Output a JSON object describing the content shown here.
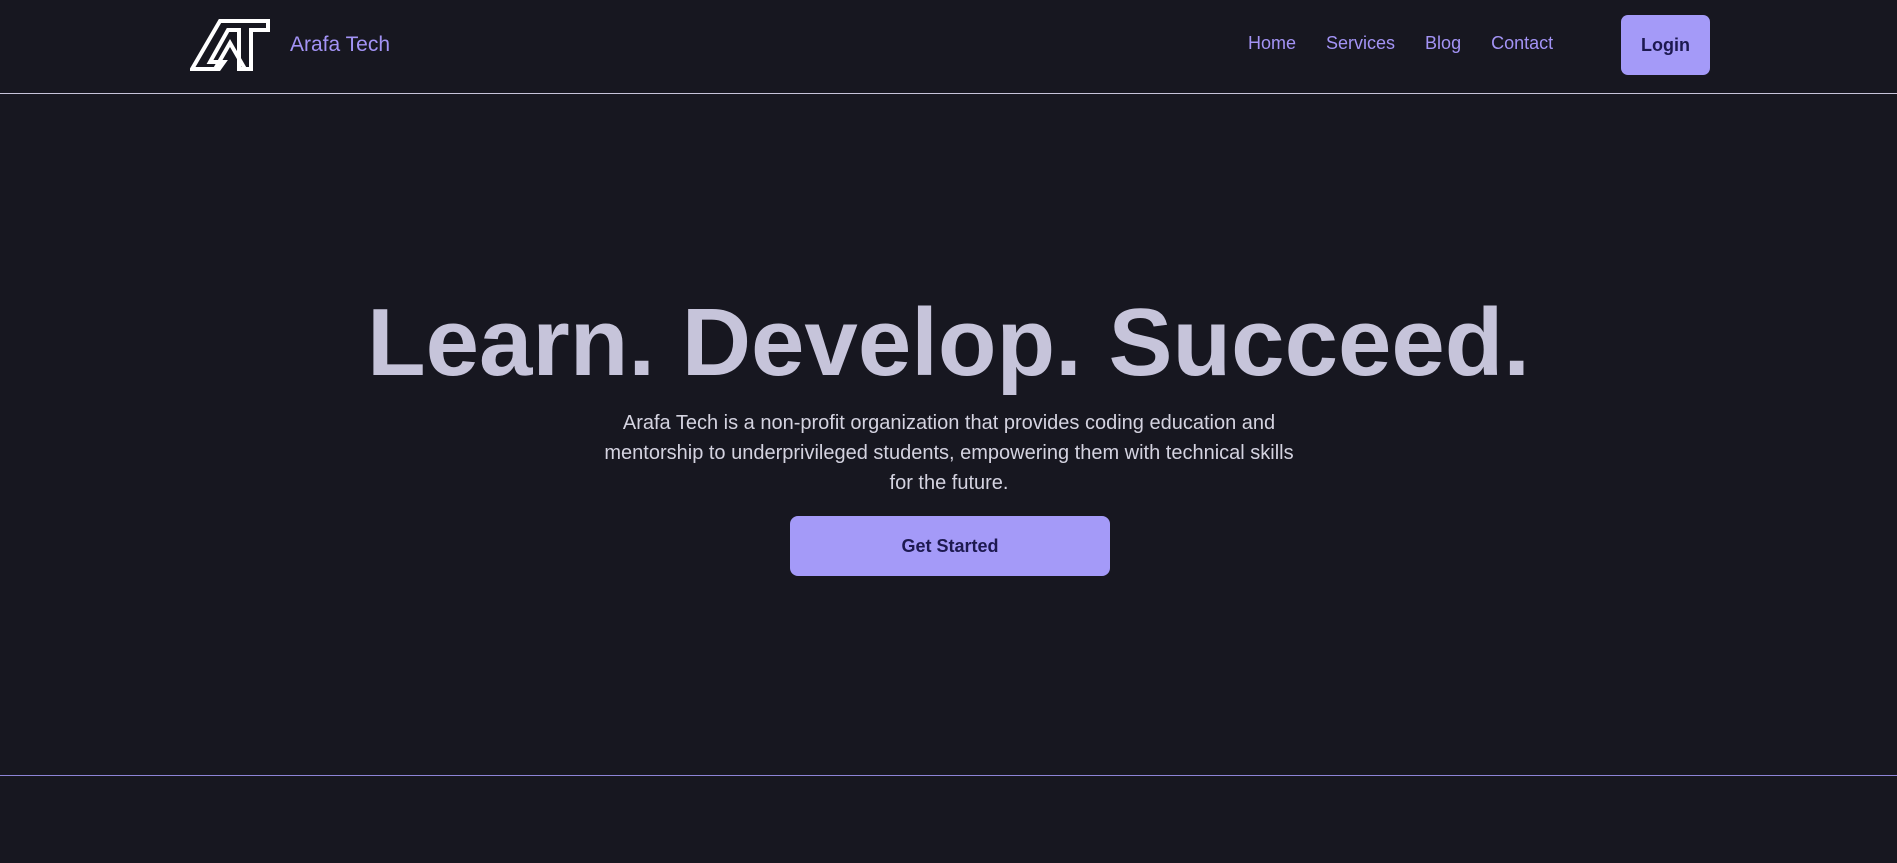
{
  "brand": {
    "logo_icon": "arafa-tech-logo-icon",
    "name": "Arafa Tech"
  },
  "navigation": {
    "items": [
      {
        "label": "Home"
      },
      {
        "label": "Services"
      },
      {
        "label": "Blog"
      },
      {
        "label": "Contact"
      }
    ],
    "login_label": "Login"
  },
  "hero": {
    "title": "Learn. Develop. Succeed.",
    "description": "Arafa Tech is a non-profit organization that provides coding education and mentorship to underprivileged students, empowering them with technical skills for the future.",
    "cta_label": "Get Started"
  },
  "colors": {
    "page_background": "#171720",
    "accent": "#a49af8",
    "accent_text": "#1d1950",
    "title_text": "#c6c4da",
    "body_text": "#d4d3e0"
  }
}
